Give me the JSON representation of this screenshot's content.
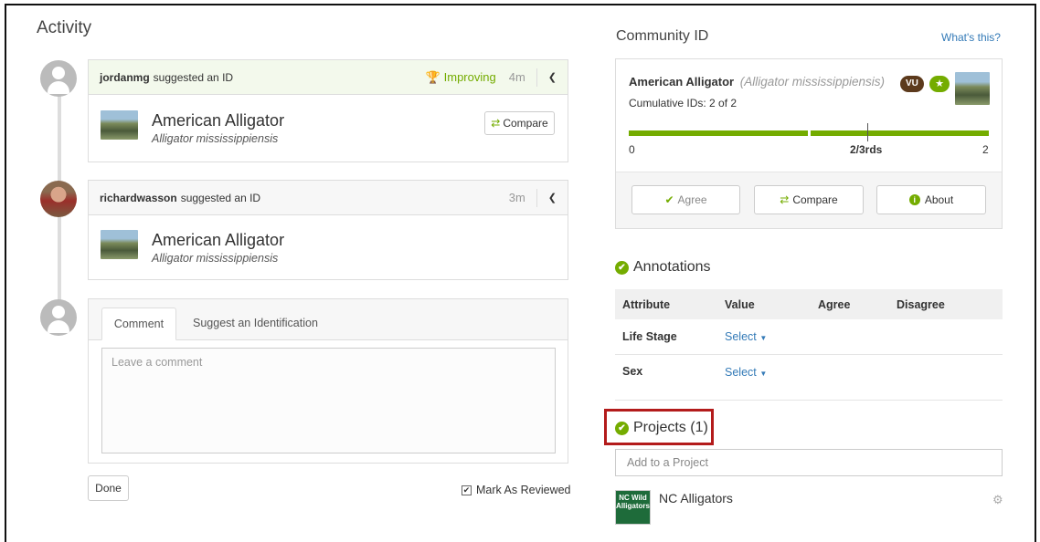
{
  "activity": {
    "title": "Activity",
    "items": [
      {
        "user": "jordanmg",
        "action": "suggested an ID",
        "status": "Improving",
        "time": "4m",
        "taxon_common": "American Alligator",
        "taxon_scientific": "Alligator mississippiensis",
        "compare_label": "Compare"
      },
      {
        "user": "richardwasson",
        "action": "suggested an ID",
        "time": "3m",
        "taxon_common": "American Alligator",
        "taxon_scientific": "Alligator mississippiensis"
      }
    ],
    "tabs": [
      "Comment",
      "Suggest an Identification"
    ],
    "comment_placeholder": "Leave a comment",
    "done_label": "Done",
    "mark_reviewed_label": "Mark As Reviewed",
    "mark_reviewed_checked": true
  },
  "community": {
    "title": "Community ID",
    "whats_this": "What's this?",
    "taxon_common": "American Alligator",
    "taxon_scientific": "(Alligator mississippiensis)",
    "badge_status": "VU",
    "cumulative": "Cumulative IDs: 2 of 2",
    "scale_min": "0",
    "scale_mid": "2/3rds",
    "scale_max": "2",
    "agree_fraction": 1.0,
    "buttons": {
      "agree": "Agree",
      "compare": "Compare",
      "about": "About"
    }
  },
  "annotations": {
    "title": "Annotations",
    "columns": [
      "Attribute",
      "Value",
      "Agree",
      "Disagree"
    ],
    "rows": [
      {
        "attribute": "Life Stage",
        "value": "Select"
      },
      {
        "attribute": "Sex",
        "value": "Select"
      }
    ]
  },
  "projects": {
    "title": "Projects (1)",
    "add_placeholder": "Add to a Project",
    "items": [
      {
        "name": "NC Alligators",
        "thumb_text": "NC Wild Alligators"
      }
    ]
  },
  "colors": {
    "accent_green": "#74ac00",
    "link_blue": "#337ab7",
    "highlight_red": "#b31b1b",
    "badge_brown": "#5c3a1c"
  }
}
